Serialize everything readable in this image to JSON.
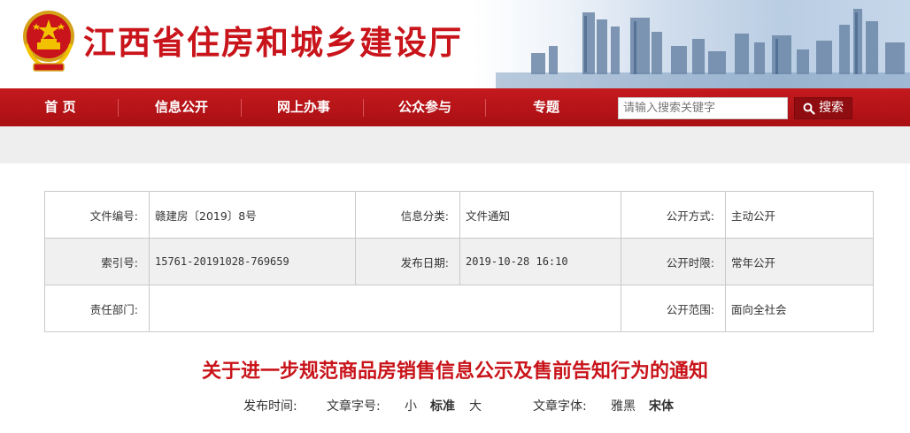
{
  "header": {
    "site_title": "江西省住房和城乡建设厅",
    "emblem_icon": "national-emblem-icon",
    "accent_color": "#c8141a"
  },
  "nav": {
    "items": [
      {
        "label": "首 页"
      },
      {
        "label": "信息公开"
      },
      {
        "label": "网上办事"
      },
      {
        "label": "公众参与"
      },
      {
        "label": "专题"
      }
    ],
    "background_color": "#b5141a"
  },
  "search": {
    "placeholder": "请输入搜索关键字",
    "button_label": "搜索",
    "button_icon": "search-icon"
  },
  "info": {
    "rows": [
      [
        {
          "label": "文件编号:",
          "value": "赣建房〔2019〕8号"
        },
        {
          "label": "信息分类:",
          "value": "文件通知"
        },
        {
          "label": "公开方式:",
          "value": "主动公开"
        }
      ],
      [
        {
          "label": "索引号:",
          "value": "15761-20191028-769659"
        },
        {
          "label": "发布日期:",
          "value": "2019-10-28 16:10"
        },
        {
          "label": "公开时限:",
          "value": "常年公开"
        }
      ],
      [
        {
          "label": "责任部门:",
          "value": ""
        },
        {
          "label": "公开范围:",
          "value": "面向全社会"
        }
      ]
    ]
  },
  "article": {
    "title": "关于进一步规范商品房销售信息公示及售前告知行为的通知",
    "meta": {
      "publish_time_label": "发布时间:",
      "font_size_label": "文章字号:",
      "size_small": "小",
      "size_standard": "标准",
      "size_large": "大",
      "font_face_label": "文章字体:",
      "font_yahei": "雅黑",
      "font_songti": "宋体"
    }
  }
}
